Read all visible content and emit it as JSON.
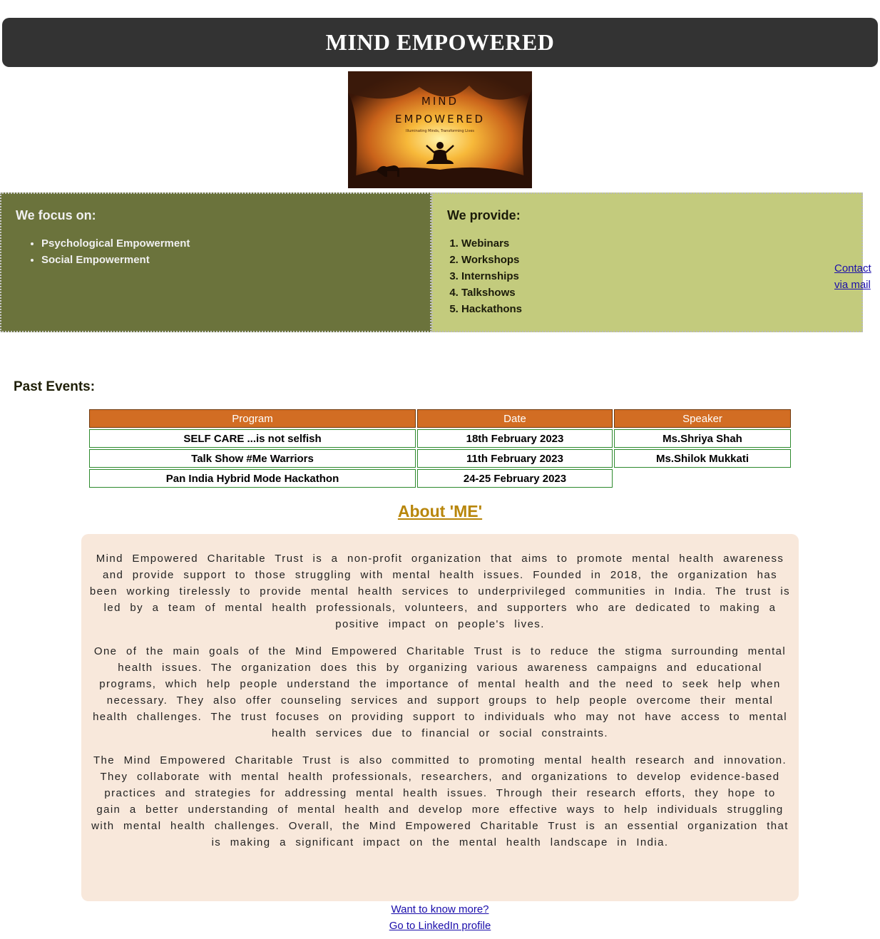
{
  "header": {
    "title": "MIND EMPOWERED"
  },
  "logo": {
    "line1": "MIND",
    "line2": "EMPOWERED",
    "tagline": "Illuminating Minds, Transforming Lives"
  },
  "focus": {
    "title": "We focus on:",
    "items": [
      "Psychological Empowerment",
      "Social Empowerment"
    ]
  },
  "provide": {
    "title": "We provide:",
    "items": [
      "Webinars",
      "Workshops",
      "Internships",
      "Talkshows",
      "Hackathons"
    ]
  },
  "contact": {
    "line1": "Contact",
    "line2": "via mail"
  },
  "past_events": {
    "title": "Past Events:",
    "columns": [
      "Program",
      "Date",
      "Speaker"
    ],
    "rows": [
      [
        "SELF CARE ...is not selfish",
        "18th February 2023",
        "Ms.Shriya Shah"
      ],
      [
        "Talk Show #Me Warriors",
        "11th February 2023",
        "Ms.Shilok Mukkati"
      ],
      [
        "Pan India Hybrid Mode Hackathon",
        "24-25 February 2023",
        ""
      ]
    ]
  },
  "about": {
    "title": "About 'ME'",
    "paragraphs": [
      "Mind Empowered Charitable Trust is a non-profit organization that aims to promote mental health awareness and provide support to those struggling with mental health issues. Founded in 2018, the organization has been working tirelessly to provide mental health services to underprivileged communities in India. The trust is led by a team of mental health professionals, volunteers, and supporters who are dedicated to making a positive impact on people's lives.",
      "One of the main goals of the Mind Empowered Charitable Trust is to reduce the stigma surrounding mental health issues. The organization does this by organizing various awareness campaigns and educational programs, which help people understand the importance of mental health and the need to seek help when necessary. They also offer counseling services and support groups to help people overcome their mental health challenges. The trust focuses on providing support to individuals who may not have access to mental health services due to financial or social constraints.",
      "The Mind Empowered Charitable Trust is also committed to promoting mental health research and innovation. They collaborate with mental health professionals, researchers, and organizations to develop evidence-based practices and strategies for addressing mental health issues. Through their research efforts, they hope to gain a better understanding of mental health and develop more effective ways to help individuals struggling with mental health challenges. Overall, the Mind Empowered Charitable Trust is an essential organization that is making a significant impact on the mental health landscape in India."
    ]
  },
  "links": {
    "know_more": "Want to know more?",
    "linkedin": "Go to LinkedIn profile"
  },
  "colors": {
    "header_bg": "#333333",
    "focus_bg": "#6b733c",
    "provide_bg": "#c3cb7d",
    "table_header": "#d26d23",
    "table_border": "#2d8a2d",
    "about_title": "#b8860b",
    "about_bg": "#f8e8db",
    "link": "#1a0dab"
  }
}
